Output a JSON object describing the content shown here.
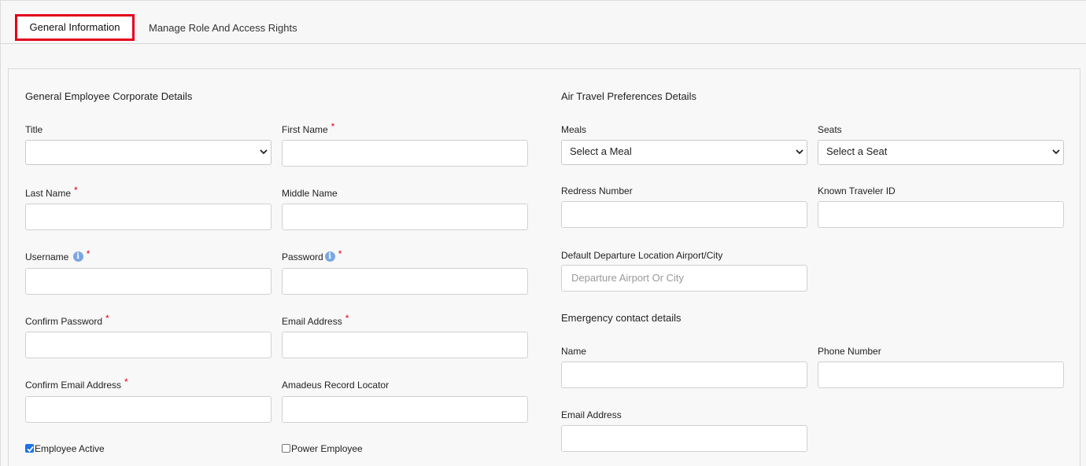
{
  "tabs": {
    "general": "General Information",
    "roles": "Manage Role And Access Rights"
  },
  "left": {
    "title": "General Employee Corporate Details",
    "title_field": {
      "label": "Title",
      "value": ""
    },
    "first_name": {
      "label": "First Name",
      "required": "*"
    },
    "last_name": {
      "label": "Last Name",
      "required": "*"
    },
    "middle_name": {
      "label": "Middle Name"
    },
    "username": {
      "label": "Username",
      "info": "i",
      "required": "*"
    },
    "password": {
      "label": "Password",
      "info": "i",
      "required": "*"
    },
    "confirm_password": {
      "label": "Confirm Password",
      "required": "*"
    },
    "email": {
      "label": "Email Address",
      "required": "*"
    },
    "confirm_email": {
      "label": "Confirm Email Address",
      "required": "*"
    },
    "amadeus": {
      "label": "Amadeus Record Locator"
    },
    "employee_active": {
      "label": "Employee Active",
      "checked": true
    },
    "power_employee": {
      "label": "Power Employee",
      "checked": false
    }
  },
  "right": {
    "title": "Air Travel Preferences Details",
    "meals": {
      "label": "Meals",
      "value": "Select a Meal"
    },
    "seats": {
      "label": "Seats",
      "value": "Select a Seat"
    },
    "redress": {
      "label": "Redress Number"
    },
    "known_traveler": {
      "label": "Known Traveler ID"
    },
    "departure": {
      "label": "Default Departure Location Airport/City",
      "placeholder": "Departure Airport Or City"
    },
    "emergency_title": "Emergency contact details",
    "em_name": {
      "label": "Name"
    },
    "em_phone": {
      "label": "Phone Number"
    },
    "em_email": {
      "label": "Email Address"
    }
  },
  "colors": {
    "accent_red": "#e3001b",
    "info_blue": "#7aa7e0",
    "check_blue": "#1a73e8"
  }
}
